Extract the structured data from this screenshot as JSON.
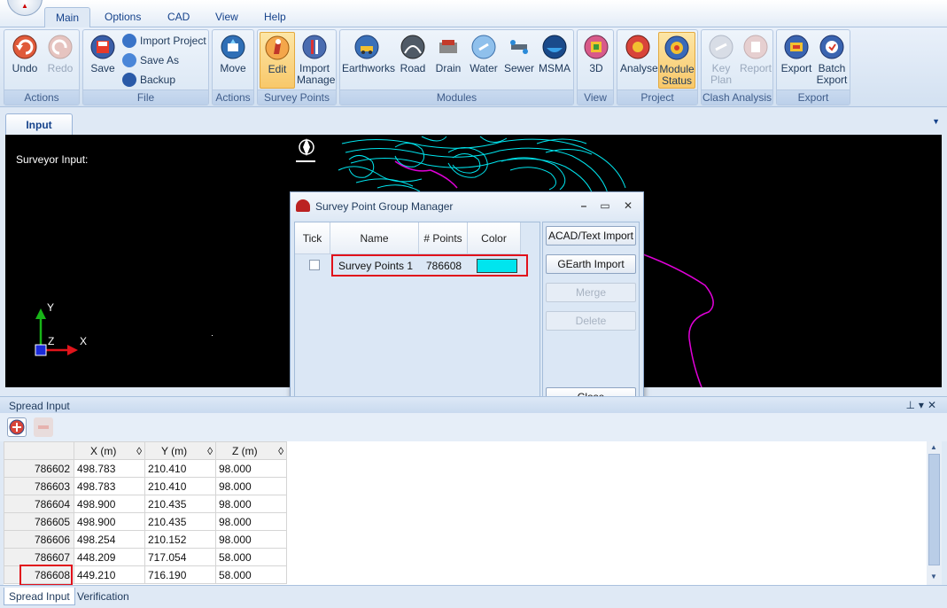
{
  "ribbon": {
    "tabs": [
      "Main",
      "Options",
      "CAD",
      "View",
      "Help"
    ],
    "groups": {
      "actions1": {
        "label": "Actions",
        "undo": "Undo",
        "redo": "Redo"
      },
      "file": {
        "label": "File",
        "save": "Save",
        "import_project": "Import Project",
        "save_as": "Save As",
        "backup": "Backup"
      },
      "actions2": {
        "label": "Actions",
        "move": "Move"
      },
      "survey_points": {
        "label": "Survey Points",
        "edit": "Edit",
        "import_manage_1": "Import",
        "import_manage_2": "Manage"
      },
      "modules": {
        "label": "Modules",
        "items": [
          "Earthworks",
          "Road",
          "Drain",
          "Water",
          "Sewer",
          "MSMA"
        ]
      },
      "view": {
        "label": "View",
        "three_d": "3D"
      },
      "project": {
        "label": "Project",
        "analyse": "Analyse",
        "module_status_1": "Module",
        "module_status_2": "Status"
      },
      "clash": {
        "label": "Clash Analysis",
        "key_plan_1": "Key",
        "key_plan_2": "Plan",
        "report": "Report"
      },
      "export": {
        "label": "Export",
        "export": "Export",
        "batch_export_1": "Batch",
        "batch_export_2": "Export"
      }
    }
  },
  "doc_tabs": {
    "input": "Input"
  },
  "viewport": {
    "surveyor_label": "Surveyor Input:",
    "axis_y": "Y",
    "axis_x": "X",
    "axis_z": "Z"
  },
  "dialog": {
    "title": "Survey Point Group Manager",
    "columns": [
      "Tick",
      "Name",
      "# Points",
      "Color"
    ],
    "row": {
      "checked": false,
      "name": "Survey Points 1",
      "points": "786608",
      "color": "#00e5ee"
    },
    "buttons": {
      "acad_import": "ACAD/Text Import",
      "gearth_import": "GEarth Import",
      "merge": "Merge",
      "delete": "Delete",
      "close": "Close"
    }
  },
  "spread": {
    "title": "Spread Input",
    "columns": [
      "X (m)",
      "Y (m)",
      "Z (m)"
    ],
    "rows": [
      {
        "id": "786602",
        "x": "498.783",
        "y": "210.410",
        "z": "98.000"
      },
      {
        "id": "786603",
        "x": "498.783",
        "y": "210.410",
        "z": "98.000"
      },
      {
        "id": "786604",
        "x": "498.900",
        "y": "210.435",
        "z": "98.000"
      },
      {
        "id": "786605",
        "x": "498.900",
        "y": "210.435",
        "z": "98.000"
      },
      {
        "id": "786606",
        "x": "498.254",
        "y": "210.152",
        "z": "98.000"
      },
      {
        "id": "786607",
        "x": "448.209",
        "y": "717.054",
        "z": "58.000"
      },
      {
        "id": "786608",
        "x": "449.210",
        "y": "716.190",
        "z": "58.000"
      }
    ],
    "bottom_tabs": [
      "Spread Input",
      "Verification"
    ]
  },
  "colors": {
    "accent": "#15428b",
    "highlight": "#e1111b",
    "cad_cyan": "#00e5ee",
    "cad_magenta": "#e000d8"
  }
}
